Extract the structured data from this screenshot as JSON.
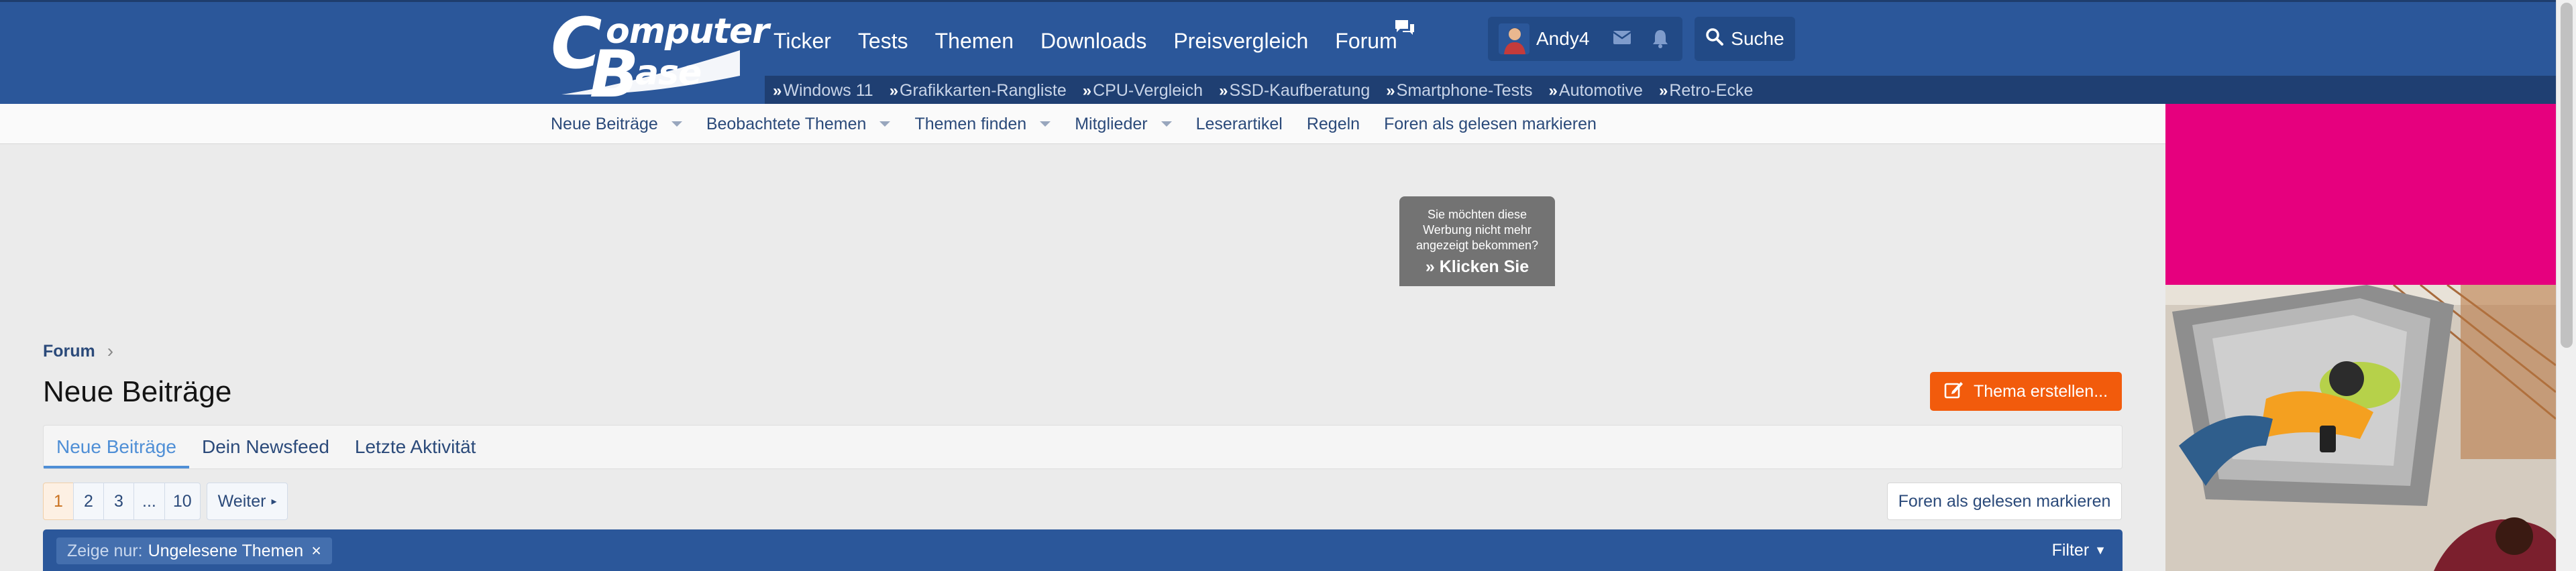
{
  "header": {
    "logo_text": "ComputerBase",
    "main_nav": [
      {
        "label": "Ticker"
      },
      {
        "label": "Tests"
      },
      {
        "label": "Themen"
      },
      {
        "label": "Downloads"
      },
      {
        "label": "Preisvergleich"
      },
      {
        "label": "Forum"
      }
    ],
    "username": "Andy4",
    "search_label": "Suche",
    "sub_nav": [
      {
        "label": "Windows 11"
      },
      {
        "label": "Grafikkarten-Rangliste"
      },
      {
        "label": "CPU-Vergleich"
      },
      {
        "label": "SSD-Kaufberatung"
      },
      {
        "label": "Smartphone-Tests"
      },
      {
        "label": "Automotive"
      },
      {
        "label": "Retro-Ecke"
      }
    ],
    "colors": {
      "header_bg": "#2b579a",
      "sub_nav_bg": "#1f3f72"
    }
  },
  "secondary_nav": [
    {
      "label": "Neue Beiträge",
      "dropdown": true
    },
    {
      "label": "Beobachtete Themen",
      "dropdown": true
    },
    {
      "label": "Themen finden",
      "dropdown": true
    },
    {
      "label": "Mitglieder",
      "dropdown": true
    },
    {
      "label": "Leserartikel",
      "dropdown": false
    },
    {
      "label": "Regeln",
      "dropdown": false
    },
    {
      "label": "Foren als gelesen markieren",
      "dropdown": false
    }
  ],
  "ad": {
    "line1": "Sie möchten diese",
    "line2": "Werbung nicht mehr",
    "line3": "angezeigt bekommen?",
    "cta": "» Klicken Sie",
    "side_ad_color": "#e6007e"
  },
  "content": {
    "breadcrumb": "Forum",
    "page_title": "Neue Beiträge",
    "create_button": "Thema erstellen...",
    "tabs": [
      {
        "label": "Neue Beiträge",
        "active": true
      },
      {
        "label": "Dein Newsfeed",
        "active": false
      },
      {
        "label": "Letzte Aktivität",
        "active": false
      }
    ],
    "pagination": {
      "pages": [
        "1",
        "2",
        "3",
        "...",
        "10"
      ],
      "current": "1",
      "next_label": "Weiter"
    },
    "mark_read_button": "Foren als gelesen markieren",
    "filter": {
      "chip_prefix": "Zeige nur:",
      "chip_value": "Ungelesene Themen",
      "chip_remove": "×",
      "filter_button": "Filter"
    }
  }
}
